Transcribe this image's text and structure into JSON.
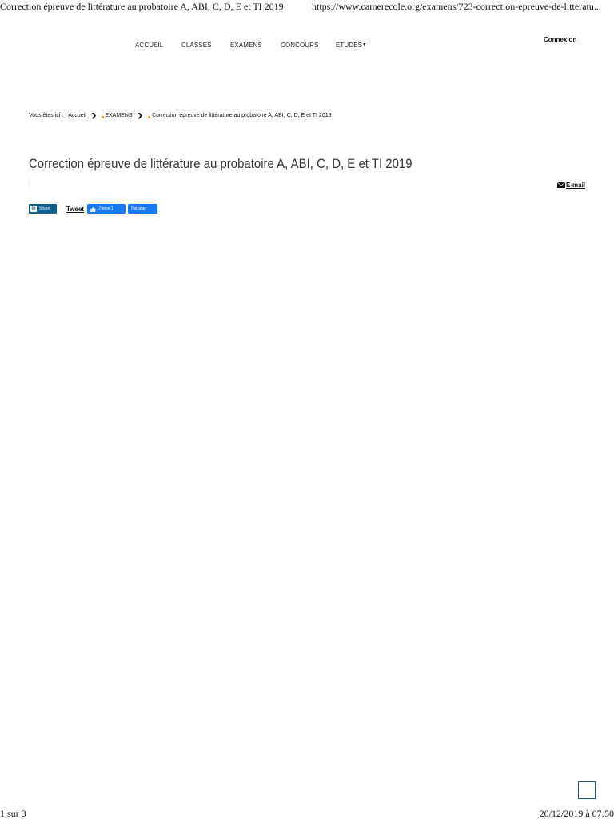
{
  "print_header": {
    "title": "Correction épreuve de littérature au probatoire A, ABI, C, D, E et TI 2019",
    "url": "https://www.camerecole.org/examens/723-correction-epreuve-de-litteratu..."
  },
  "nav": {
    "items": [
      "ACCUEIL",
      "CLASSES",
      "EXAMENS",
      "CONCOURS",
      "ETUDES"
    ],
    "dropdown_arrow": "▾",
    "login": "Connexion"
  },
  "breadcrumb": {
    "prefix": "Vous êtes ici :",
    "home": "Accueil",
    "section": "EXAMENS",
    "current": "Correction épreuve de littérature au probatoire A, ABI, C, D, E et TI 2019",
    "separator": "❯"
  },
  "article": {
    "title": "Correction épreuve de littérature au probatoire A, ABI, C, D, E et TI 2019",
    "email_label": "E-mail",
    "email_icon": "envelope-icon"
  },
  "social": {
    "linkedin_label": "Share",
    "linkedin_icon": "linkedin-icon",
    "tweet_label": "Tweet",
    "fb_like_label": "J'aime 1",
    "fb_share_label": "Partager",
    "colors": {
      "linkedin": "#0e5f8e",
      "facebook": "#1877f2"
    }
  },
  "print_footer": {
    "page": "1 sur 3",
    "date": "20/12/2019 à 07:50"
  }
}
